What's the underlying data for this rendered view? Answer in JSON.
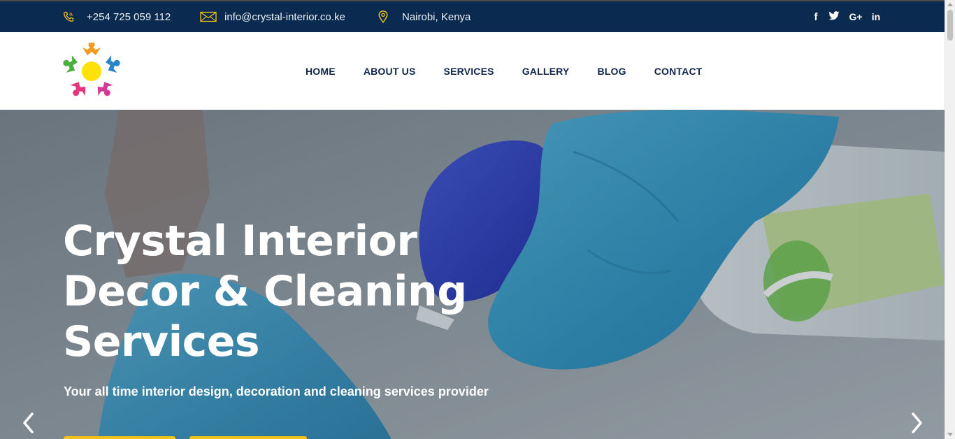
{
  "topbar": {
    "phone": "+254 725 059 112",
    "email": "info@crystal-interior.co.ke",
    "location": "Nairobi, Kenya",
    "social": [
      {
        "icon": "facebook-icon",
        "glyph": "f"
      },
      {
        "icon": "twitter-icon",
        "glyph": "t"
      },
      {
        "icon": "google-plus-icon",
        "glyph": "G+"
      },
      {
        "icon": "linkedin-icon",
        "glyph": "in"
      }
    ]
  },
  "nav": {
    "items": [
      "HOME",
      "ABOUT US",
      "SERVICES",
      "GALLERY",
      "BLOG",
      "CONTACT"
    ]
  },
  "hero": {
    "title_line1": "Crystal Interior",
    "title_line2": "Decor & Cleaning",
    "title_line3": "Services",
    "subtitle": "Your all time interior design, decoration and cleaning services provider",
    "prev_icon": "chevron-left-icon",
    "next_icon": "chevron-right-icon"
  },
  "colors": {
    "topbar_bg": "#0b2a4f",
    "accent_gold": "#f2c21b",
    "nav_text": "#10264a",
    "glove_blue": "#3ea6d1"
  }
}
